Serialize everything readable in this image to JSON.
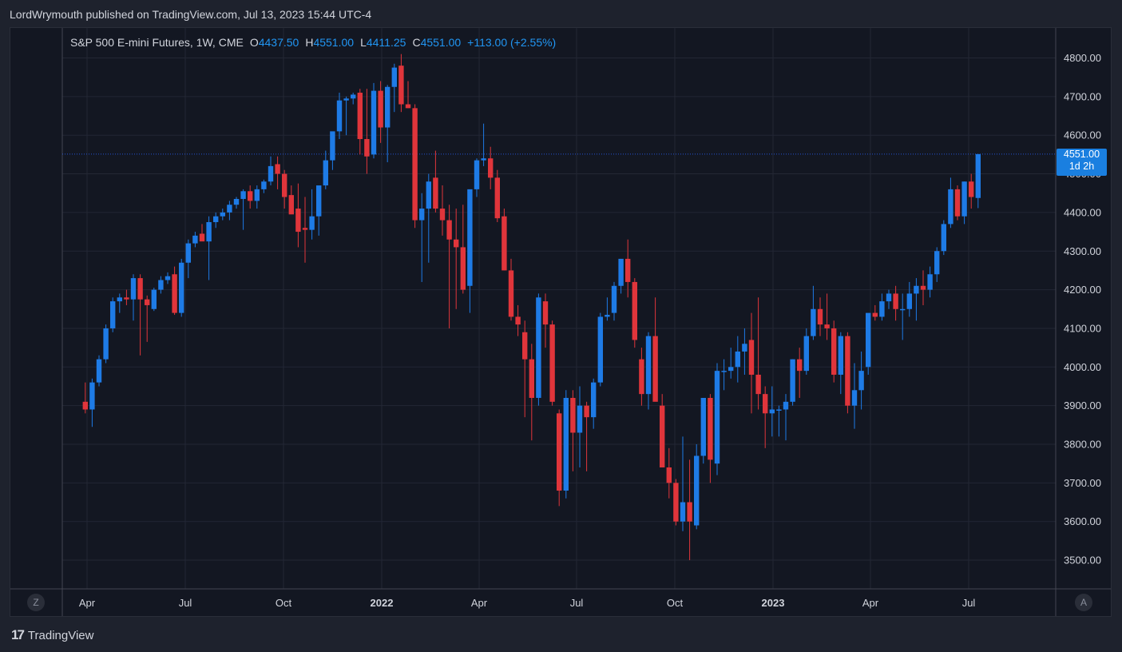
{
  "header": {
    "published": "LordWrymouth published on TradingView.com, Jul 13, 2023 15:44 UTC-4"
  },
  "legend": {
    "symbol": "S&P 500 E-mini Futures, 1W, CME",
    "o_label": "O",
    "o": "4437.50",
    "h_label": "H",
    "h": "4551.00",
    "l_label": "L",
    "l": "4411.25",
    "c_label": "C",
    "c": "4551.00",
    "change": "+113.00 (+2.55%)"
  },
  "price_badge": {
    "price": "4551.00",
    "countdown": "1d 2h"
  },
  "buttons": {
    "zoom": "Z",
    "auto": "A"
  },
  "footer": {
    "brand": "TradingView",
    "brand_mark": "17"
  },
  "colors": {
    "up": "#1e7be6",
    "down": "#e0353b",
    "background": "#131722",
    "grid": "#232734",
    "axis_text": "#d1d4dc"
  },
  "chart_data": {
    "type": "candlestick",
    "timeframe": "1W",
    "ylim": [
      3450,
      4850
    ],
    "y_ticks": [
      3500,
      3600,
      3700,
      3800,
      3900,
      4000,
      4100,
      4200,
      4300,
      4400,
      4500,
      4600,
      4700,
      4800
    ],
    "x_ticks": [
      "Apr",
      "Jul",
      "Oct",
      "2022",
      "Apr",
      "Jul",
      "Oct",
      "2023",
      "Apr",
      "Jul"
    ],
    "last_price": 4551.0,
    "candles": [
      {
        "o": 3910,
        "h": 3960,
        "l": 3880,
        "c": 3890
      },
      {
        "o": 3890,
        "h": 3970,
        "l": 3845,
        "c": 3960
      },
      {
        "o": 3960,
        "h": 4030,
        "l": 3950,
        "c": 4020
      },
      {
        "o": 4020,
        "h": 4110,
        "l": 4010,
        "c": 4100
      },
      {
        "o": 4100,
        "h": 4180,
        "l": 4090,
        "c": 4170
      },
      {
        "o": 4170,
        "h": 4190,
        "l": 4140,
        "c": 4180
      },
      {
        "o": 4180,
        "h": 4200,
        "l": 4160,
        "c": 4175
      },
      {
        "o": 4175,
        "h": 4240,
        "l": 4120,
        "c": 4230
      },
      {
        "o": 4230,
        "h": 4240,
        "l": 4030,
        "c": 4175
      },
      {
        "o": 4175,
        "h": 4185,
        "l": 4065,
        "c": 4160
      },
      {
        "o": 4150,
        "h": 4205,
        "l": 4145,
        "c": 4200
      },
      {
        "o": 4200,
        "h": 4235,
        "l": 4190,
        "c": 4225
      },
      {
        "o": 4225,
        "h": 4245,
        "l": 4215,
        "c": 4235
      },
      {
        "o": 4240,
        "h": 4260,
        "l": 4135,
        "c": 4140
      },
      {
        "o": 4140,
        "h": 4280,
        "l": 4130,
        "c": 4270
      },
      {
        "o": 4270,
        "h": 4330,
        "l": 4230,
        "c": 4320
      },
      {
        "o": 4320,
        "h": 4350,
        "l": 4310,
        "c": 4340
      },
      {
        "o": 4345,
        "h": 4370,
        "l": 4330,
        "c": 4325
      },
      {
        "o": 4325,
        "h": 4390,
        "l": 4225,
        "c": 4375
      },
      {
        "o": 4375,
        "h": 4400,
        "l": 4360,
        "c": 4390
      },
      {
        "o": 4390,
        "h": 4410,
        "l": 4380,
        "c": 4400
      },
      {
        "o": 4400,
        "h": 4430,
        "l": 4380,
        "c": 4420
      },
      {
        "o": 4420,
        "h": 4440,
        "l": 4410,
        "c": 4435
      },
      {
        "o": 4435,
        "h": 4460,
        "l": 4355,
        "c": 4455
      },
      {
        "o": 4455,
        "h": 4470,
        "l": 4410,
        "c": 4430
      },
      {
        "o": 4430,
        "h": 4470,
        "l": 4410,
        "c": 4460
      },
      {
        "o": 4460,
        "h": 4485,
        "l": 4450,
        "c": 4480
      },
      {
        "o": 4480,
        "h": 4545,
        "l": 4470,
        "c": 4520
      },
      {
        "o": 4525,
        "h": 4545,
        "l": 4460,
        "c": 4500
      },
      {
        "o": 4500,
        "h": 4510,
        "l": 4410,
        "c": 4440
      },
      {
        "o": 4445,
        "h": 4470,
        "l": 4400,
        "c": 4395
      },
      {
        "o": 4410,
        "h": 4475,
        "l": 4310,
        "c": 4350
      },
      {
        "o": 4360,
        "h": 4440,
        "l": 4270,
        "c": 4355
      },
      {
        "o": 4355,
        "h": 4460,
        "l": 4330,
        "c": 4390
      },
      {
        "o": 4390,
        "h": 4450,
        "l": 4340,
        "c": 4470
      },
      {
        "o": 4470,
        "h": 4560,
        "l": 4460,
        "c": 4535
      },
      {
        "o": 4535,
        "h": 4600,
        "l": 4510,
        "c": 4610
      },
      {
        "o": 4610,
        "h": 4710,
        "l": 4590,
        "c": 4690
      },
      {
        "o": 4690,
        "h": 4700,
        "l": 4600,
        "c": 4695
      },
      {
        "o": 4695,
        "h": 4710,
        "l": 4680,
        "c": 4705
      },
      {
        "o": 4710,
        "h": 4720,
        "l": 4550,
        "c": 4590
      },
      {
        "o": 4590,
        "h": 4720,
        "l": 4500,
        "c": 4545
      },
      {
        "o": 4550,
        "h": 4735,
        "l": 4540,
        "c": 4715
      },
      {
        "o": 4715,
        "h": 4740,
        "l": 4580,
        "c": 4620
      },
      {
        "o": 4620,
        "h": 4730,
        "l": 4530,
        "c": 4725
      },
      {
        "o": 4725,
        "h": 4785,
        "l": 4660,
        "c": 4775
      },
      {
        "o": 4780,
        "h": 4810,
        "l": 4660,
        "c": 4680
      },
      {
        "o": 4680,
        "h": 4740,
        "l": 4670,
        "c": 4670
      },
      {
        "o": 4670,
        "h": 4680,
        "l": 4360,
        "c": 4380
      },
      {
        "o": 4380,
        "h": 4450,
        "l": 4220,
        "c": 4410
      },
      {
        "o": 4410,
        "h": 4500,
        "l": 4270,
        "c": 4480
      },
      {
        "o": 4490,
        "h": 4560,
        "l": 4400,
        "c": 4410
      },
      {
        "o": 4410,
        "h": 4470,
        "l": 4340,
        "c": 4380
      },
      {
        "o": 4380,
        "h": 4420,
        "l": 4100,
        "c": 4330
      },
      {
        "o": 4330,
        "h": 4410,
        "l": 4150,
        "c": 4310
      },
      {
        "o": 4310,
        "h": 4420,
        "l": 4190,
        "c": 4200
      },
      {
        "o": 4210,
        "h": 4390,
        "l": 4140,
        "c": 4460
      },
      {
        "o": 4460,
        "h": 4540,
        "l": 4440,
        "c": 4535
      },
      {
        "o": 4535,
        "h": 4630,
        "l": 4520,
        "c": 4540
      },
      {
        "o": 4540,
        "h": 4570,
        "l": 4460,
        "c": 4490
      },
      {
        "o": 4490,
        "h": 4510,
        "l": 4375,
        "c": 4385
      },
      {
        "o": 4390,
        "h": 4410,
        "l": 4250,
        "c": 4250
      },
      {
        "o": 4250,
        "h": 4280,
        "l": 4120,
        "c": 4130
      },
      {
        "o": 4130,
        "h": 4160,
        "l": 4080,
        "c": 4110
      },
      {
        "o": 4090,
        "h": 4120,
        "l": 3870,
        "c": 4020
      },
      {
        "o": 4020,
        "h": 4060,
        "l": 3810,
        "c": 3920
      },
      {
        "o": 3920,
        "h": 4190,
        "l": 3900,
        "c": 4180
      },
      {
        "o": 4170,
        "h": 4190,
        "l": 4050,
        "c": 4110
      },
      {
        "o": 4110,
        "h": 4120,
        "l": 3900,
        "c": 3910
      },
      {
        "o": 3880,
        "h": 3890,
        "l": 3640,
        "c": 3680
      },
      {
        "o": 3680,
        "h": 3940,
        "l": 3660,
        "c": 3920
      },
      {
        "o": 3920,
        "h": 3940,
        "l": 3730,
        "c": 3830
      },
      {
        "o": 3830,
        "h": 3950,
        "l": 3740,
        "c": 3900
      },
      {
        "o": 3900,
        "h": 3910,
        "l": 3730,
        "c": 3870
      },
      {
        "o": 3870,
        "h": 3970,
        "l": 3840,
        "c": 3960
      },
      {
        "o": 3960,
        "h": 4140,
        "l": 3950,
        "c": 4130
      },
      {
        "o": 4130,
        "h": 4180,
        "l": 4120,
        "c": 4135
      },
      {
        "o": 4140,
        "h": 4220,
        "l": 4120,
        "c": 4210
      },
      {
        "o": 4210,
        "h": 4280,
        "l": 4190,
        "c": 4280
      },
      {
        "o": 4280,
        "h": 4330,
        "l": 4180,
        "c": 4220
      },
      {
        "o": 4220,
        "h": 4230,
        "l": 4050,
        "c": 4070
      },
      {
        "o": 4020,
        "h": 4050,
        "l": 3900,
        "c": 3930
      },
      {
        "o": 3930,
        "h": 4090,
        "l": 3890,
        "c": 4080
      },
      {
        "o": 4080,
        "h": 4180,
        "l": 3960,
        "c": 3910
      },
      {
        "o": 3900,
        "h": 3930,
        "l": 3740,
        "c": 3740
      },
      {
        "o": 3740,
        "h": 3790,
        "l": 3660,
        "c": 3700
      },
      {
        "o": 3700,
        "h": 3710,
        "l": 3590,
        "c": 3600
      },
      {
        "o": 3600,
        "h": 3820,
        "l": 3575,
        "c": 3650
      },
      {
        "o": 3650,
        "h": 3760,
        "l": 3500,
        "c": 3600
      },
      {
        "o": 3590,
        "h": 3800,
        "l": 3580,
        "c": 3770
      },
      {
        "o": 3770,
        "h": 3910,
        "l": 3750,
        "c": 3920
      },
      {
        "o": 3920,
        "h": 3930,
        "l": 3700,
        "c": 3760
      },
      {
        "o": 3750,
        "h": 4010,
        "l": 3720,
        "c": 3990
      },
      {
        "o": 3990,
        "h": 4020,
        "l": 3940,
        "c": 3990
      },
      {
        "o": 3990,
        "h": 4050,
        "l": 3970,
        "c": 4000
      },
      {
        "o": 4000,
        "h": 4080,
        "l": 3960,
        "c": 4040
      },
      {
        "o": 4040,
        "h": 4100,
        "l": 3980,
        "c": 4060
      },
      {
        "o": 4070,
        "h": 4140,
        "l": 3880,
        "c": 3980
      },
      {
        "o": 3980,
        "h": 4180,
        "l": 3890,
        "c": 3930
      },
      {
        "o": 3930,
        "h": 3950,
        "l": 3790,
        "c": 3880
      },
      {
        "o": 3880,
        "h": 3950,
        "l": 3820,
        "c": 3890
      },
      {
        "o": 3890,
        "h": 3900,
        "l": 3820,
        "c": 3890
      },
      {
        "o": 3890,
        "h": 3930,
        "l": 3810,
        "c": 3910
      },
      {
        "o": 3910,
        "h": 4020,
        "l": 3900,
        "c": 4020
      },
      {
        "o": 4020,
        "h": 4050,
        "l": 3920,
        "c": 3990
      },
      {
        "o": 3990,
        "h": 4100,
        "l": 3980,
        "c": 4080
      },
      {
        "o": 4080,
        "h": 4210,
        "l": 4070,
        "c": 4150
      },
      {
        "o": 4150,
        "h": 4180,
        "l": 4080,
        "c": 4110
      },
      {
        "o": 4110,
        "h": 4190,
        "l": 4070,
        "c": 4100
      },
      {
        "o": 4100,
        "h": 4120,
        "l": 3960,
        "c": 3980
      },
      {
        "o": 3980,
        "h": 4090,
        "l": 3930,
        "c": 4080
      },
      {
        "o": 4080,
        "h": 4090,
        "l": 3880,
        "c": 3900
      },
      {
        "o": 3900,
        "h": 4010,
        "l": 3840,
        "c": 3940
      },
      {
        "o": 3940,
        "h": 4040,
        "l": 3890,
        "c": 3990
      },
      {
        "o": 4000,
        "h": 4100,
        "l": 3980,
        "c": 4140
      },
      {
        "o": 4140,
        "h": 4160,
        "l": 4120,
        "c": 4130
      },
      {
        "o": 4130,
        "h": 4190,
        "l": 4120,
        "c": 4170
      },
      {
        "o": 4170,
        "h": 4200,
        "l": 4150,
        "c": 4190
      },
      {
        "o": 4190,
        "h": 4210,
        "l": 4120,
        "c": 4150
      },
      {
        "o": 4150,
        "h": 4190,
        "l": 4070,
        "c": 4150
      },
      {
        "o": 4150,
        "h": 4220,
        "l": 4130,
        "c": 4190
      },
      {
        "o": 4190,
        "h": 4230,
        "l": 4120,
        "c": 4210
      },
      {
        "o": 4210,
        "h": 4250,
        "l": 4160,
        "c": 4200
      },
      {
        "o": 4200,
        "h": 4260,
        "l": 4180,
        "c": 4240
      },
      {
        "o": 4240,
        "h": 4310,
        "l": 4220,
        "c": 4300
      },
      {
        "o": 4300,
        "h": 4380,
        "l": 4290,
        "c": 4370
      },
      {
        "o": 4370,
        "h": 4490,
        "l": 4360,
        "c": 4460
      },
      {
        "o": 4460,
        "h": 4470,
        "l": 4380,
        "c": 4390
      },
      {
        "o": 4390,
        "h": 4480,
        "l": 4370,
        "c": 4480
      },
      {
        "o": 4480,
        "h": 4500,
        "l": 4410,
        "c": 4440
      },
      {
        "o": 4437.5,
        "h": 4551,
        "l": 4411.25,
        "c": 4551
      }
    ],
    "last_candle_index": 133
  }
}
